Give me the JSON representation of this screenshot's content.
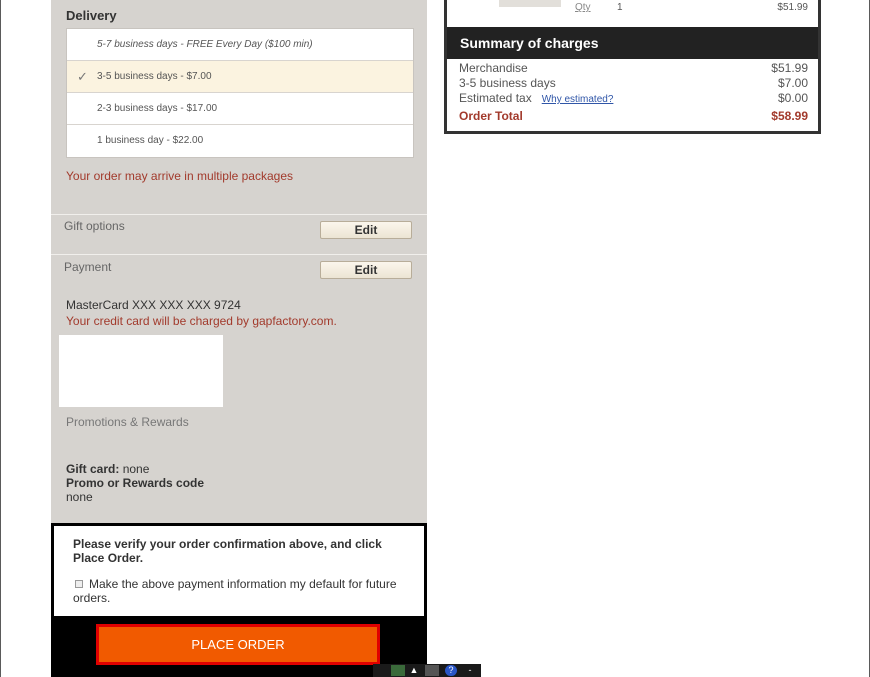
{
  "delivery": {
    "title": "Delivery",
    "options": [
      {
        "label": "5-7 business days - FREE Every Day ($100 min)",
        "selected": false
      },
      {
        "label": "3-5 business days - $7.00",
        "selected": true
      },
      {
        "label": "2-3 business days - $17.00",
        "selected": false
      },
      {
        "label": "1 business day - $22.00",
        "selected": false
      }
    ],
    "check_glyph": "✓",
    "multi_package_note": "Your order may arrive in multiple packages"
  },
  "gift_options": {
    "label": "Gift options",
    "edit_label": "Edit"
  },
  "payment": {
    "label": "Payment",
    "edit_label": "Edit",
    "card_line": "MasterCard  XXX XXX XXX 9724",
    "charge_note": "Your credit card will be charged by gapfactory.com."
  },
  "promotions": {
    "label": "Promotions & Rewards",
    "gift_card_label": "Gift card:",
    "gift_card_value": "none",
    "promo_label": "Promo or Rewards code",
    "promo_value": "none"
  },
  "confirm": {
    "verify_text": "Please verify your order confirmation above, and click Place Order.",
    "default_payment_label": "Make the above payment information my default for future orders.",
    "place_order_label": "PLACE ORDER"
  },
  "item": {
    "qty_label": "Qty",
    "qty_value": "1",
    "price": "$51.99"
  },
  "summary": {
    "title": "Summary of charges",
    "rows": [
      {
        "label": "Merchandise",
        "value": "$51.99"
      },
      {
        "label": "3-5 business days",
        "value": "$7.00"
      },
      {
        "label": "Estimated tax",
        "link": "Why estimated?",
        "value": "$0.00"
      }
    ],
    "total_label": "Order Total",
    "total_value": "$58.99"
  },
  "colors": {
    "accent_red": "#a23a2c",
    "place_order": "#f15a00",
    "place_order_border": "#e00000",
    "panel_grey": "#d6d3cf"
  }
}
